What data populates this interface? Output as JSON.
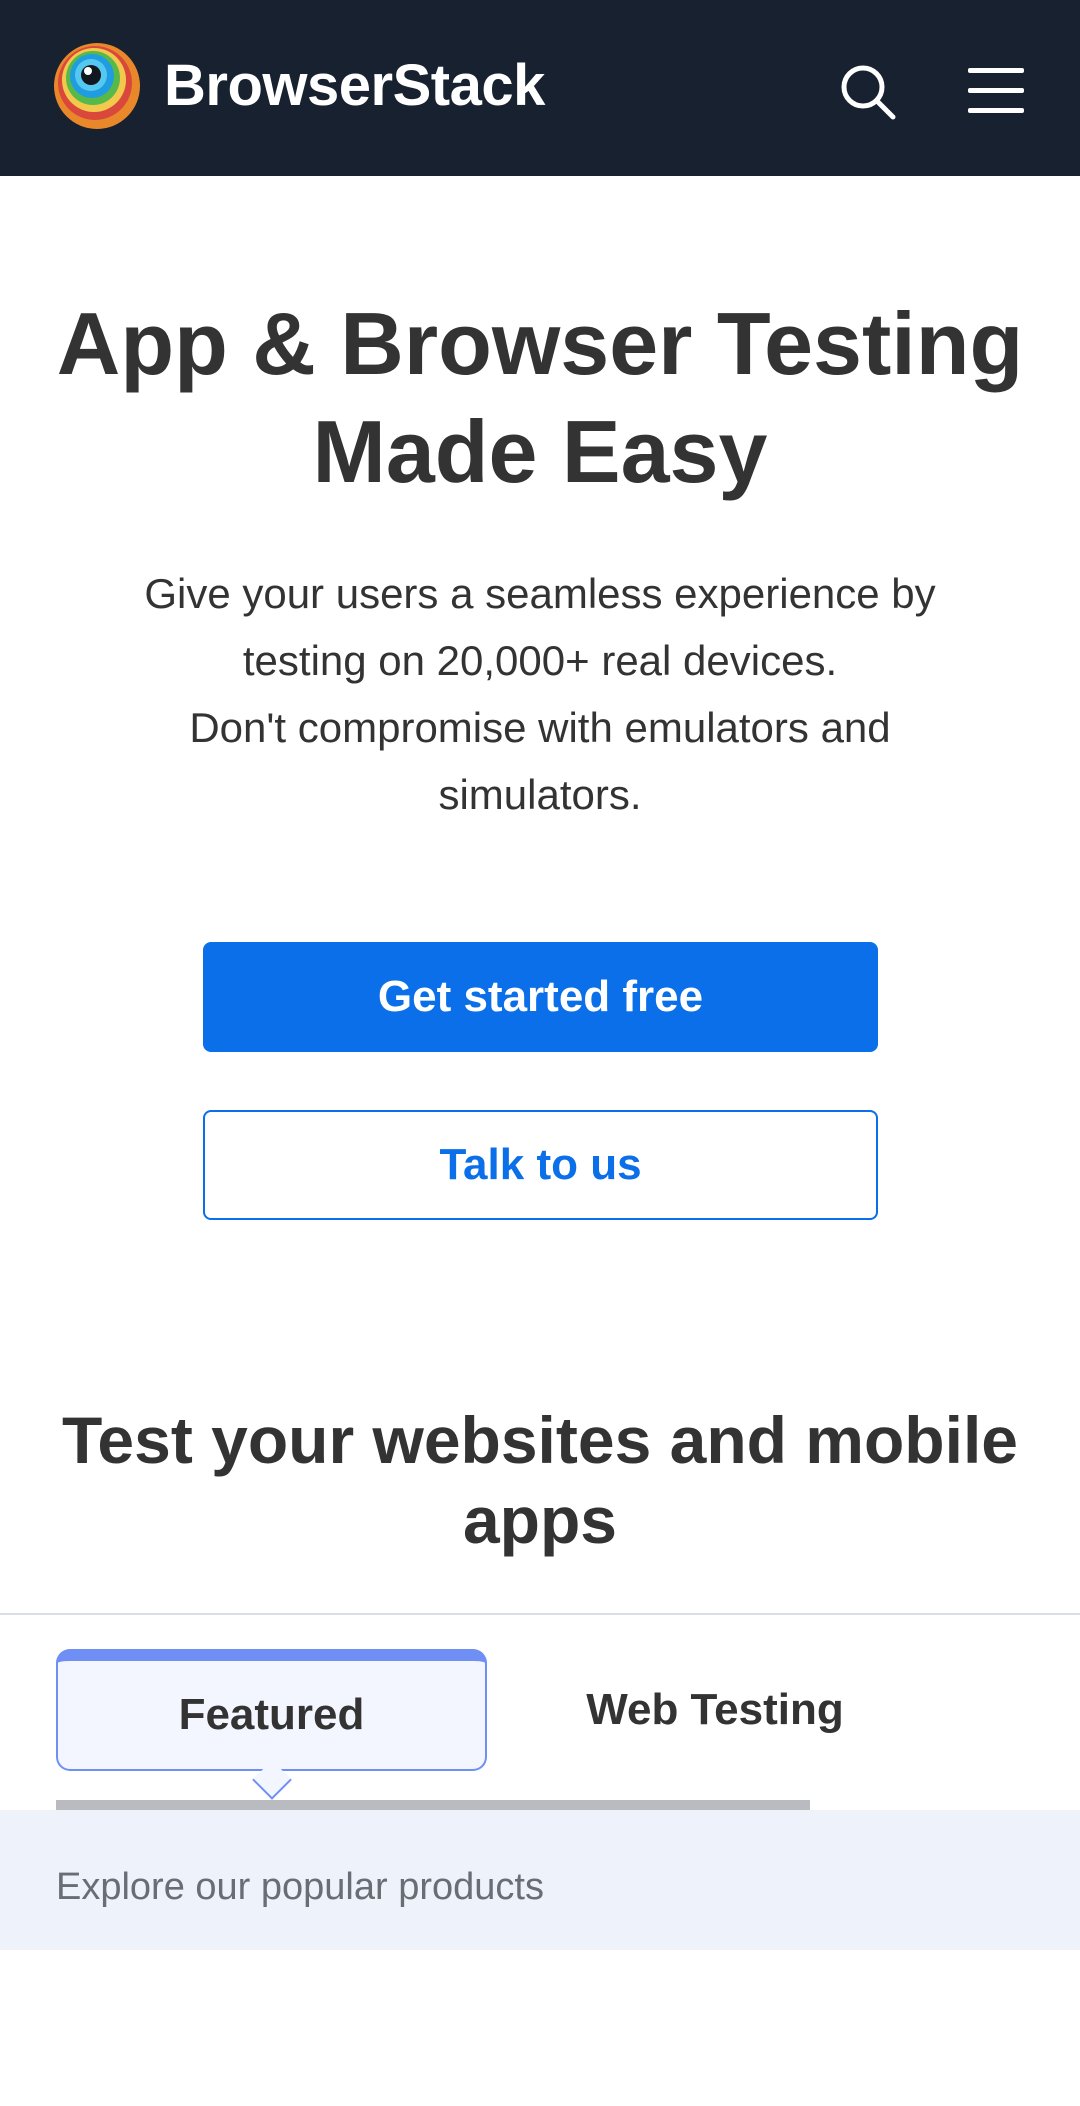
{
  "header": {
    "brand": "BrowserStack",
    "logo_icon": "browserstack-logo-icon",
    "search_icon": "search-icon",
    "menu_icon": "hamburger-menu-icon"
  },
  "hero": {
    "title_line1": "App & Browser Testing",
    "title_line2": "Made Easy",
    "subtitle_line1": "Give your users a seamless experience by",
    "subtitle_line2": "testing on 20,000+ real devices.",
    "subtitle_line3": "Don't compromise with emulators and",
    "subtitle_line4": "simulators.",
    "primary_cta": "Get started free",
    "secondary_cta": "Talk to us"
  },
  "products": {
    "title_line1": "Test your websites and mobile",
    "title_line2": "apps",
    "tabs": [
      {
        "label": "Featured",
        "selected": true
      },
      {
        "label": "Web Testing",
        "selected": false
      }
    ],
    "panel_text": "Explore our popular products"
  },
  "colors": {
    "header_bg": "#17212f",
    "accent": "#0a6fe8",
    "tab_highlight": "#6f8ff5",
    "panel_bg": "#eef2fb"
  }
}
